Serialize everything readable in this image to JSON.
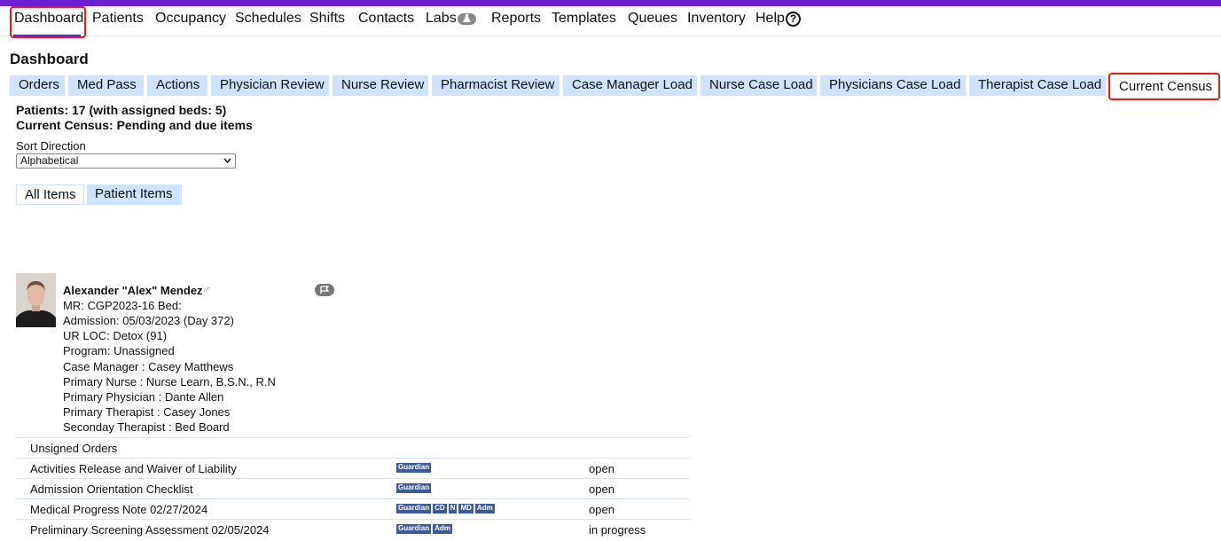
{
  "nav": {
    "items": [
      "Dashboard",
      "Patients",
      "Occupancy",
      "Schedules",
      "Shifts",
      "Contacts",
      "Labs",
      "Reports",
      "Templates",
      "Queues",
      "Inventory",
      "Help"
    ],
    "help_glyph": "?"
  },
  "page": {
    "title": "Dashboard"
  },
  "subtabs": [
    "Orders",
    "Med Pass",
    "Actions",
    "Physician Review",
    "Nurse Review",
    "Pharmacist Review",
    "Case Manager Load",
    "Nurse Case Load",
    "Physicians Case Load",
    "Therapist Case Load",
    "Current Census"
  ],
  "census": {
    "patients_line": "Patients: 17 (with assigned beds: 5)",
    "subtitle": "Current Census: Pending and due items"
  },
  "sort": {
    "label": "Sort Direction",
    "value": "Alphabetical"
  },
  "item_tabs": {
    "all": "All Items",
    "patient": "Patient Items"
  },
  "patient": {
    "name": "Alexander \"Alex\" Mendez",
    "gender_symbol": "♂",
    "lines": [
      "MR: CGP2023-16    Bed:",
      "Admission: 05/03/2023 (Day 372)",
      "UR LOC: Detox (91)",
      "Program: Unassigned",
      "Case Manager  :  Casey Matthews",
      "Primary Nurse  :  Nurse Learn, B.S.N., R.N",
      "Primary Physician  :  Dante Allen",
      "Primary Therapist  :  Casey Jones",
      "Seconday Therapist  :  Bed Board"
    ]
  },
  "orders": {
    "header": "Unsigned Orders",
    "rows": [
      {
        "name": "Activities Release and Waiver of Liability",
        "tags": [
          "Guardian"
        ],
        "status": "open"
      },
      {
        "name": "Admission Orientation Checklist",
        "tags": [
          "Guardian"
        ],
        "status": "open"
      },
      {
        "name": "Medical Progress Note 02/27/2024",
        "tags": [
          "Guardian",
          "CD",
          "N",
          "MD",
          "Adm"
        ],
        "status": "open"
      },
      {
        "name": "Preliminary Screening Assessment 02/05/2024",
        "tags": [
          "Guardian",
          "Adm"
        ],
        "status": "in progress"
      }
    ]
  },
  "icons": {
    "labs": "flask-icon",
    "help": "help-circle-icon",
    "gender": "male-icon",
    "flag": "flag-icon",
    "dropdown": "chevron-down-icon"
  },
  "colors": {
    "brand": "#6a1fd0",
    "tab_bg": "#cfe2ff",
    "highlight": "#e21b1b",
    "tag_bg": "#3d5a99"
  }
}
